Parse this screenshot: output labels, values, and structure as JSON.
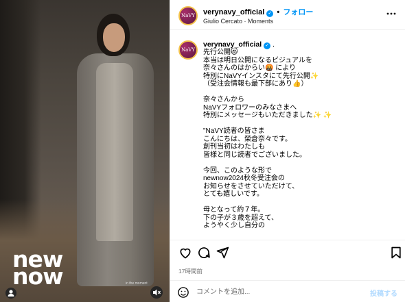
{
  "photo": {
    "logo_text": "new now",
    "overlay_caption": "in the moment",
    "user_tag_icon": "person-icon",
    "mute_icon": "speaker-muted-icon"
  },
  "header": {
    "avatar_text": "NaVY",
    "username": "verynavy_official",
    "dot": "•",
    "follow_label": "フォロー",
    "audio": "Giulio Cercato · Moments",
    "more_icon": "more-horizontal-icon"
  },
  "caption": {
    "username": "verynavy_official",
    "username_tail": " .",
    "lines": [
      "先行公開😻",
      "本当は明日公開になるビジュアルを",
      "奈々さんのはからい🤬 により",
      "特別にNaVYインスタにて先行公開✨",
      "（受注会情報も最下部にあり👍）",
      "",
      "奈々さんから",
      "NaVYフォロワーのみなさまへ",
      "特別にメッセージもいただきました✨ ✨",
      "",
      "\"NaVY読者の皆さま",
      "こんにちは、榮倉奈々です。",
      "創刊当初はわたしも",
      "皆様と同じ読者でございました。",
      "",
      "今回、このような形で",
      "newnow2024秋冬受注会の",
      "お知らせをさせていただけて、",
      "とても嬉しいです。",
      "",
      "母となって約７年。",
      "下の子が３歳を超えて、",
      "ようやく少し自分の"
    ]
  },
  "actions": {
    "like_icon": "heart-icon",
    "comment_icon": "comment-icon",
    "share_icon": "send-icon",
    "save_icon": "bookmark-icon"
  },
  "time_ago": "17時間前",
  "comment_bar": {
    "emoji_icon": "smiley-icon",
    "placeholder": "コメントを追加...",
    "post_label": "投稿する"
  },
  "colors": {
    "accent": "#0095f6",
    "muted": "#737373",
    "divider": "#efefef",
    "post_disabled": "#b3dbff"
  }
}
